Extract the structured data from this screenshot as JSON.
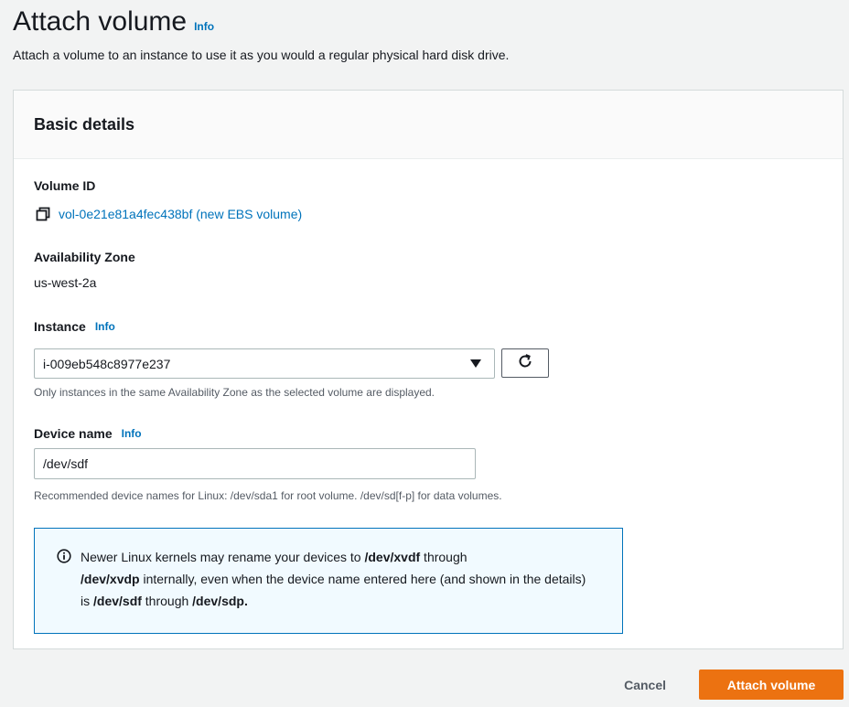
{
  "header": {
    "title": "Attach volume",
    "info": "Info",
    "description": "Attach a volume to an instance to use it as you would a regular physical hard disk drive."
  },
  "basic_details": {
    "title": "Basic details",
    "volume_id": {
      "label": "Volume ID",
      "value": "vol-0e21e81a4fec438bf (new EBS volume)",
      "icon": "copy-icon"
    },
    "availability_zone": {
      "label": "Availability Zone",
      "value": "us-west-2a"
    },
    "instance": {
      "label": "Instance",
      "info": "Info",
      "selected": "i-009eb548c8977e237",
      "help": "Only instances in the same Availability Zone as the selected volume are displayed.",
      "refresh_icon": "refresh-icon"
    },
    "device_name": {
      "label": "Device name",
      "info": "Info",
      "value": "/dev/sdf",
      "help": "Recommended device names for Linux: /dev/sda1 for root volume. /dev/sd[f-p] for data volumes."
    },
    "alert": {
      "icon": "info-circle-icon",
      "part1": "Newer Linux kernels may rename your devices to ",
      "bold1": "/dev/xvdf",
      "part2": " through ",
      "bold2": "/dev/xvdp",
      "part3": " internally, even when the device name entered here (and shown in the details) is ",
      "bold3": "/dev/sdf",
      "part4": " through ",
      "bold4": "/dev/sdp."
    }
  },
  "footer": {
    "cancel": "Cancel",
    "submit": "Attach volume"
  },
  "colors": {
    "link": "#0073bb",
    "primary_button": "#ec7211",
    "alert_bg": "#f1faff",
    "alert_border": "#0073bb"
  }
}
